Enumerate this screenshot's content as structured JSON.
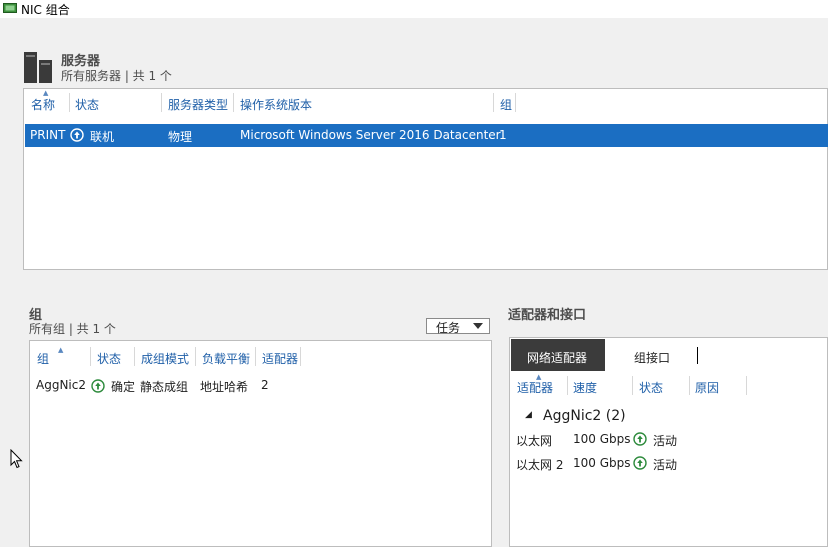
{
  "window": {
    "title": "NIC 组合"
  },
  "servers": {
    "title": "服务器",
    "subtitle": "所有服务器 | 共 1 个",
    "columns": [
      "名称",
      "状态",
      "服务器类型",
      "操作系统版本",
      "组"
    ],
    "rows": [
      {
        "name": "PRINT",
        "status": "联机",
        "type": "物理",
        "os": "Microsoft Windows Server 2016 Datacenter",
        "groups": "1"
      }
    ]
  },
  "groups": {
    "title": "组",
    "subtitle": "所有组 | 共 1 个",
    "tasks_label": "任务",
    "columns": [
      "组",
      "状态",
      "成组模式",
      "负载平衡",
      "适配器"
    ],
    "rows": [
      {
        "name": "AggNic2",
        "status": "确定",
        "mode": "静态成组",
        "lb": "地址哈希",
        "adapters": "2"
      }
    ]
  },
  "adapters": {
    "title": "适配器和接口",
    "tabs": [
      "网络适配器",
      "组接口"
    ],
    "columns": [
      "适配器",
      "速度",
      "状态",
      "原因"
    ],
    "group_label": "AggNic2 (2)",
    "rows": [
      {
        "name": "以太网",
        "speed": "100 Gbps",
        "status": "活动"
      },
      {
        "name": "以太网 2",
        "speed": "100 Gbps",
        "status": "活动"
      }
    ]
  },
  "colors": {
    "selection": "#1b6ec2",
    "header_text": "#1f5fa8",
    "status_ok": "#2e8b3d",
    "tab_active": "#3b3b3b"
  }
}
